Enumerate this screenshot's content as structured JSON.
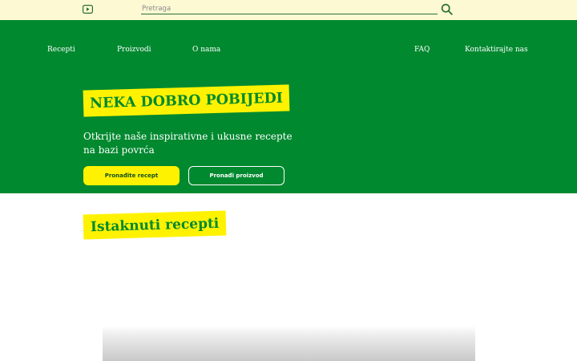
{
  "topbar": {
    "search_placeholder": "Pretraga"
  },
  "nav": {
    "items": [
      {
        "label": "Recepti"
      },
      {
        "label": "Proizvodi"
      },
      {
        "label": "O nama"
      },
      {
        "label": "FAQ"
      },
      {
        "label": "Kontaktirajte nas"
      }
    ]
  },
  "hero": {
    "title": "NEKA DOBRO POBIJEDI",
    "text": "Otkrijte naše inspirativne i ukusne recepte na bazi povrća",
    "primary_button": "Pronađite recept",
    "secondary_button": "Pronađi proizvod"
  },
  "featured": {
    "title": "Istaknuti recepti"
  },
  "colors": {
    "brand_green": "#00892f",
    "accent_yellow": "#fff200",
    "topbar_cream": "#fdf9d3"
  }
}
